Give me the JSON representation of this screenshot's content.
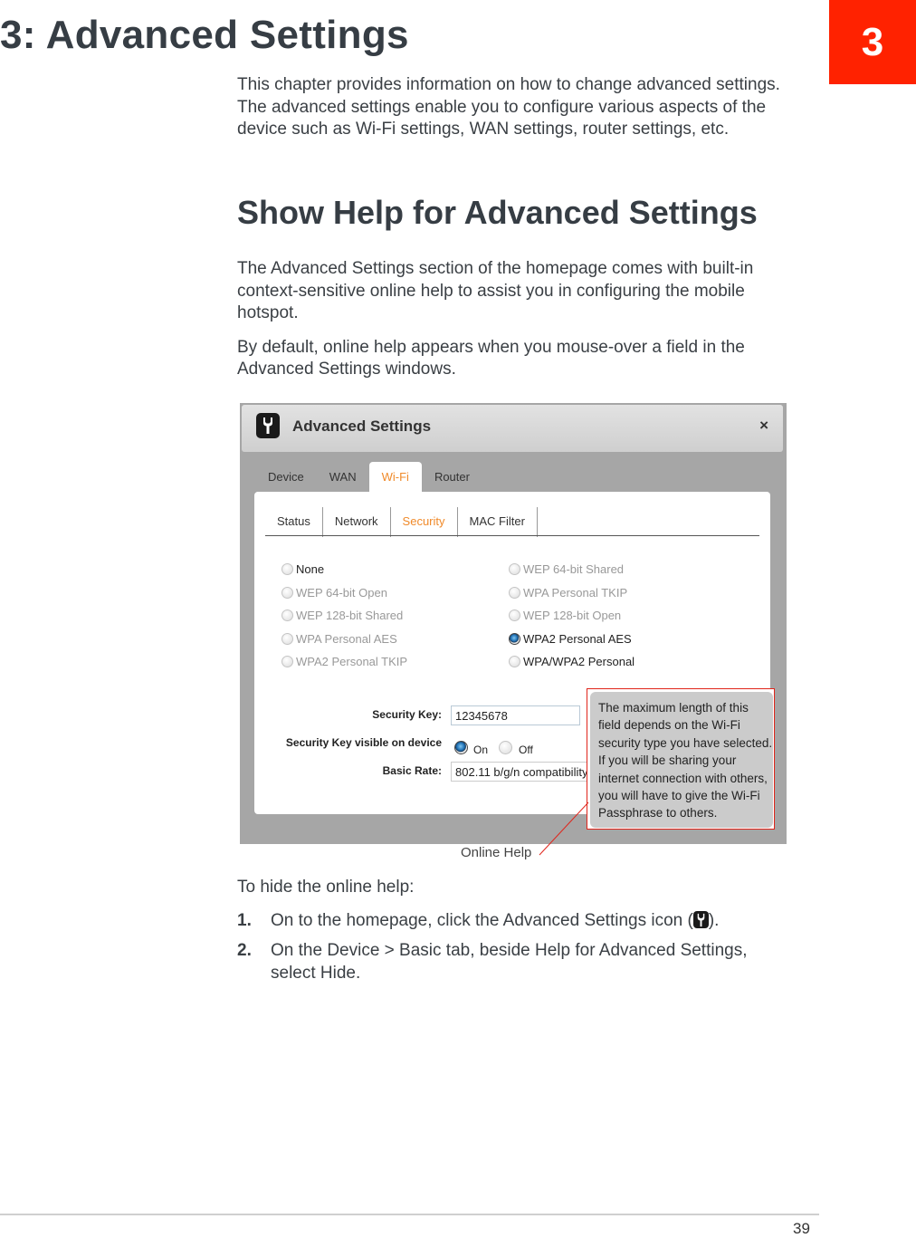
{
  "chapter": {
    "title": "3: Advanced Settings",
    "tab_number": "3",
    "intro": "This chapter provides information on how to change advanced settings. The advanced settings enable you to configure various aspects of the device such as Wi-Fi settings, WAN settings, router settings, etc.",
    "accent_color": "#ff2200"
  },
  "section": {
    "title": "Show Help for Advanced Settings",
    "para1": "The Advanced Settings section of the homepage comes with built-in context-sensitive online help to assist you in configuring the mobile hotspot.",
    "para2": "By default, online help appears when you mouse-over a field in the Advanced Settings windows."
  },
  "figure": {
    "window_title": "Advanced Settings",
    "window_icon": "wrench-icon",
    "close_label": "×",
    "main_tabs": [
      {
        "label": "Device",
        "active": false
      },
      {
        "label": "WAN",
        "active": false
      },
      {
        "label": "Wi-Fi",
        "active": true
      },
      {
        "label": "Router",
        "active": false
      }
    ],
    "sub_tabs": [
      {
        "label": "Status",
        "active": false
      },
      {
        "label": "Network",
        "active": false
      },
      {
        "label": "Security",
        "active": true
      },
      {
        "label": "MAC Filter",
        "active": false
      }
    ],
    "security_options_left": [
      {
        "label": "None",
        "enabled": true,
        "checked": false
      },
      {
        "label": "WEP 64-bit Open",
        "enabled": false,
        "checked": false
      },
      {
        "label": "WEP 128-bit Shared",
        "enabled": false,
        "checked": false
      },
      {
        "label": "WPA Personal AES",
        "enabled": false,
        "checked": false
      },
      {
        "label": "WPA2 Personal TKIP",
        "enabled": false,
        "checked": false
      }
    ],
    "security_options_right": [
      {
        "label": "WEP 64-bit Shared",
        "enabled": false,
        "checked": false
      },
      {
        "label": "WPA Personal TKIP",
        "enabled": false,
        "checked": false
      },
      {
        "label": "WEP 128-bit Open",
        "enabled": false,
        "checked": false
      },
      {
        "label": "WPA2 Personal AES",
        "enabled": true,
        "checked": true
      },
      {
        "label": "WPA/WPA2 Personal",
        "enabled": true,
        "checked": false
      }
    ],
    "security_key_label": "Security Key:",
    "security_key_value": "12345678",
    "visible_label": "Security Key visible on device",
    "visible_on_label": "On",
    "visible_off_label": "Off",
    "visible_value": "On",
    "basic_rate_label": "Basic Rate:",
    "basic_rate_value": "802.11 b/g/n compatibility",
    "help_text": "The maximum length of this field depends on the Wi-Fi security type you have selected. If you will be sharing your internet connection with others, you will have to give the Wi-Fi Passphrase to others.",
    "callout_label": "Online Help",
    "active_tab_color": "#f08a2a",
    "callout_color": "#e0241a"
  },
  "procedure": {
    "intro": "To hide the online help:",
    "steps": [
      {
        "num": "1.",
        "text_before": "On to the homepage, click the Advanced Settings icon (",
        "icon": "wrench-icon",
        "text_after": ")."
      },
      {
        "num": "2.",
        "text": "On the Device > Basic tab, beside Help for Advanced Settings, select Hide."
      }
    ]
  },
  "footer": {
    "page_number": "39"
  }
}
